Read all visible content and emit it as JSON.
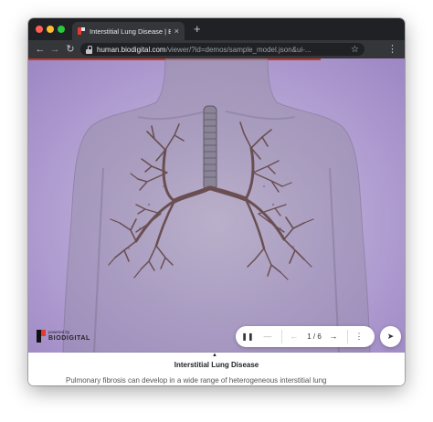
{
  "browser": {
    "tab_title": "Interstitial Lung Disease | BioD",
    "tab_close": "×",
    "new_tab": "+",
    "url_host": "human.biodigital.com",
    "url_path": "/viewer/?id=demos/sample_model.json&ui-...",
    "back": "←",
    "forward": "→",
    "reload": "↻",
    "star": "☆",
    "menu": "⋮"
  },
  "viewer": {
    "background": "#b9a8d6",
    "logo_powered": "powered by",
    "logo_name": "BIODIGITAL",
    "controls": {
      "pause": "❚❚",
      "dash": "—",
      "prev": "←",
      "counter": "1 / 6",
      "next": "→",
      "more": "⋮"
    },
    "nav_button": "➤"
  },
  "info": {
    "caret": "▲",
    "title": "Interstitial Lung Disease",
    "body": "Pulmonary fibrosis can develop in a wide range of heterogeneous interstitial lung"
  }
}
